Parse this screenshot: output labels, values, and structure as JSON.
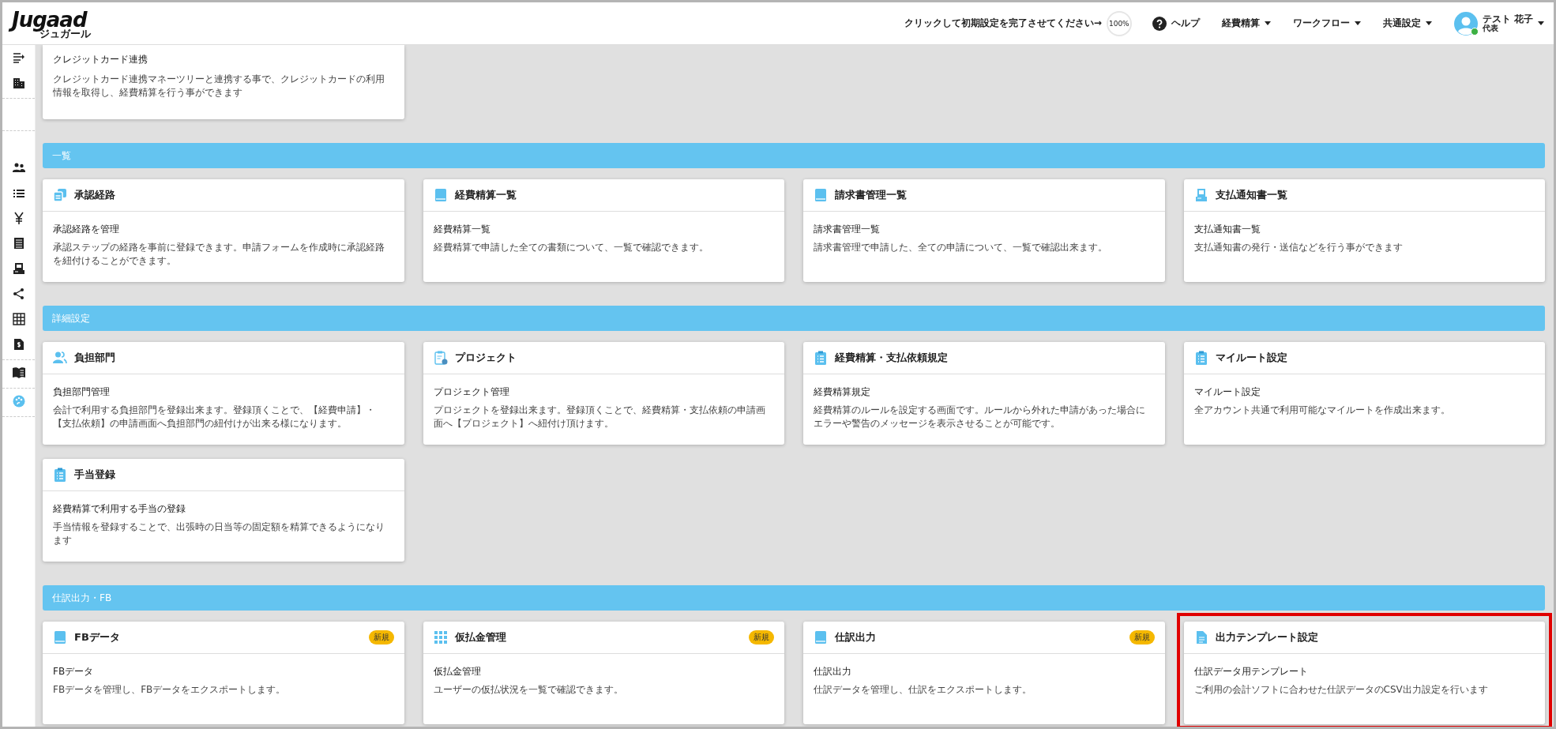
{
  "header": {
    "logo": "Jugaad",
    "logo_sub": "ジュガール",
    "setup_prompt": "クリックして初期設定を完了させてください→",
    "setup_progress": "100%",
    "help": "ヘルプ",
    "menus": [
      {
        "label": "経費精算"
      },
      {
        "label": "ワークフロー"
      },
      {
        "label": "共通設定"
      }
    ],
    "user": {
      "name": "テスト 花子",
      "role": "代表",
      "online": true
    }
  },
  "sidebar": {
    "groups": [
      {
        "items": [
          {
            "selected": false
          },
          {
            "selected": false
          }
        ]
      },
      {
        "items": [
          {
            "selected": false
          },
          {
            "selected": false
          },
          {
            "selected": false
          },
          {
            "selected": false
          },
          {
            "selected": false
          },
          {
            "selected": false
          },
          {
            "selected": false
          },
          {
            "selected": false
          }
        ]
      },
      {
        "items": [
          {
            "selected": false
          }
        ]
      },
      {
        "items": [
          {
            "selected": true
          }
        ]
      }
    ]
  },
  "sections": [
    {
      "cards": [
        {
          "kind": "plain",
          "title": "クレジットカード連携",
          "description": "クレジットカード連携マネーツリーと連携する事で、クレジットカードの利用情報を取得し、経費精算を行う事ができます"
        }
      ]
    },
    {
      "title": "一覧",
      "cards": [
        {
          "kind": "header",
          "title": "承認経路",
          "subtitle": "承認経路を管理",
          "description": "承認ステップの経路を事前に登録できます。申請フォームを作成時に承認経路を紐付けることができます。"
        },
        {
          "kind": "header",
          "title": "経費精算一覧",
          "subtitle": "経費精算一覧",
          "description": "経費精算で申請した全ての書類について、一覧で確認できます。"
        },
        {
          "kind": "header",
          "title": "請求書管理一覧",
          "subtitle": "請求書管理一覧",
          "description": "請求書管理で申請した、全ての申請について、一覧で確認出来ます。"
        },
        {
          "kind": "header",
          "title": "支払通知書一覧",
          "subtitle": "支払通知書一覧",
          "description": "支払通知書の発行・送信などを行う事ができます"
        }
      ]
    },
    {
      "title": "詳細設定",
      "cards": [
        {
          "kind": "header",
          "title": "負担部門",
          "subtitle": "負担部門管理",
          "description": "会計で利用する負担部門を登録出来ます。登録頂くことで、【経費申請】・【支払依頼】の申請画面へ負担部門の紐付けが出来る様になります。"
        },
        {
          "kind": "header",
          "title": "プロジェクト",
          "subtitle": "プロジェクト管理",
          "description": "プロジェクトを登録出来ます。登録頂くことで、経費精算・支払依頼の申請画面へ【プロジェクト】へ紐付け頂けます。"
        },
        {
          "kind": "header",
          "title": "経費精算・支払依頼規定",
          "subtitle": "経費精算規定",
          "description": "経費精算のルールを設定する画面です。ルールから外れた申請があった場合にエラーや警告のメッセージを表示させることが可能です。"
        },
        {
          "kind": "header",
          "title": "マイルート設定",
          "subtitle": "マイルート設定",
          "description": "全アカウント共通で利用可能なマイルートを作成出来ます。"
        },
        {
          "kind": "header",
          "title": "手当登録",
          "subtitle": "経費精算で利用する手当の登録",
          "description": "手当情報を登録することで、出張時の日当等の固定額を精算できるようになります"
        }
      ]
    },
    {
      "title": "仕訳出力・FB",
      "cards": [
        {
          "kind": "header",
          "title": "FBデータ",
          "badge": "新規",
          "subtitle": "FBデータ",
          "description": "FBデータを管理し、FBデータをエクスポートします。",
          "highlighted": false
        },
        {
          "kind": "header",
          "title": "仮払金管理",
          "badge": "新規",
          "subtitle": "仮払金管理",
          "description": "ユーザーの仮払状況を一覧で確認できます。",
          "highlighted": false
        },
        {
          "kind": "header",
          "title": "仕訳出力",
          "badge": "新規",
          "subtitle": "仕訳出力",
          "description": "仕訳データを管理し、仕訳をエクスポートします。",
          "highlighted": false
        },
        {
          "kind": "header",
          "title": "出力テンプレート設定",
          "subtitle": "仕訳データ用テンプレート",
          "description": "ご利用の会計ソフトに合わせた仕訳データのCSV出力設定を行います",
          "highlighted": true
        }
      ]
    }
  ]
}
